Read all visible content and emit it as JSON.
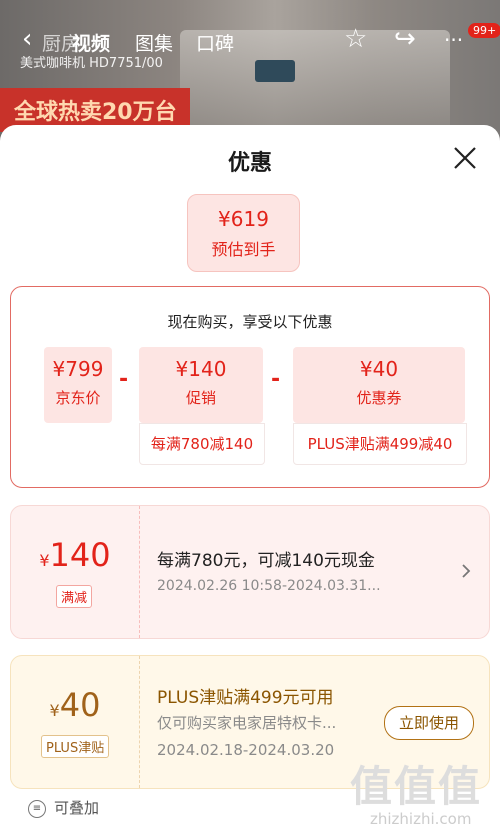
{
  "background": {
    "nav_tabs": [
      "视频",
      "图集",
      "口碑"
    ],
    "partial_title": "厨房",
    "product_subtitle": "美式咖啡机 HD7751/00",
    "banner_text": "全球热卖20万台",
    "cart_badge": "99+"
  },
  "sheet": {
    "title": "优惠",
    "estimate": {
      "price": "¥619",
      "label": "预估到手"
    },
    "calc": {
      "heading": "现在购买，享受以下优惠",
      "base": {
        "value": "¥799",
        "label": "京东价"
      },
      "promo": {
        "value": "¥140",
        "label": "促销",
        "note": "每满780减140"
      },
      "coupon": {
        "value": "¥40",
        "label": "优惠券",
        "note": "PLUS津贴满499减40"
      },
      "minus": "-"
    },
    "offers": [
      {
        "currency": "¥",
        "amount": "140",
        "tag": "满减",
        "title": "每满780元，可减140元现金",
        "validity": "2024.02.26 10:58-2024.03.31..."
      },
      {
        "currency": "¥",
        "amount": "40",
        "tag": "PLUS津贴",
        "title": "PLUS津贴满499元可用",
        "desc": "仅可购买家电家居特权卡...",
        "validity": "2024.02.18-2024.03.20",
        "action": "立即使用"
      }
    ],
    "stackable": "可叠加",
    "watermark": "值值值",
    "watermark_url": "zhizhizhi.com"
  },
  "colors": {
    "accent": "#e2231a",
    "gold": "#a0621a"
  }
}
